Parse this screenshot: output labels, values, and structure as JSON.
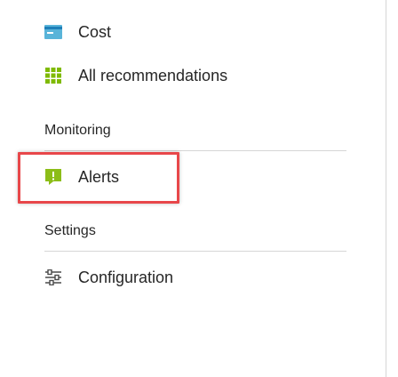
{
  "nav": {
    "cost": {
      "label": "Cost",
      "icon": "cost-card-icon",
      "icon_color": "#59b4d9"
    },
    "all_recommendations": {
      "label": "All recommendations",
      "icon": "grid-icon",
      "icon_color": "#7fba00"
    }
  },
  "sections": {
    "monitoring": {
      "title": "Monitoring",
      "items": [
        {
          "label": "Alerts",
          "icon": "alert-icon",
          "icon_color": "#8cbd18"
        }
      ]
    },
    "settings": {
      "title": "Settings",
      "items": [
        {
          "label": "Configuration",
          "icon": "sliders-icon",
          "icon_color": "#4a4a4a"
        }
      ]
    }
  },
  "colors": {
    "highlight": "#e8474a",
    "divider": "#d6d6d6",
    "text": "#262626"
  }
}
